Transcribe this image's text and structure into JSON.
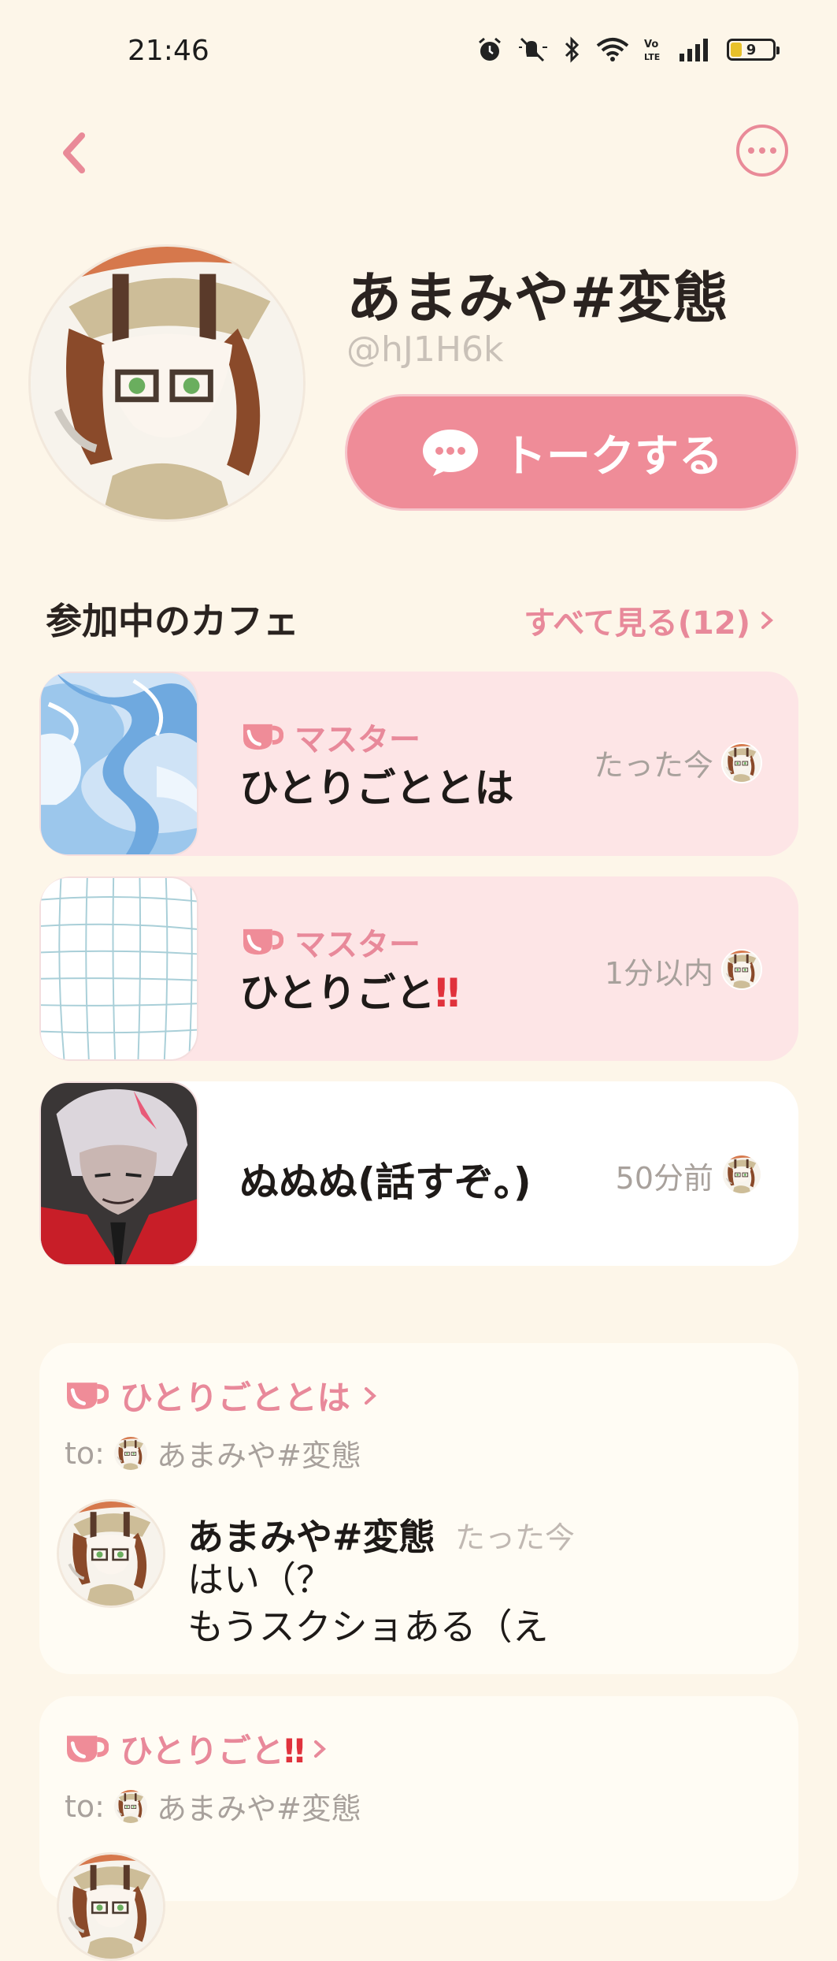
{
  "status_bar": {
    "time": "21:46",
    "battery": "9",
    "icons": [
      "alarm-icon",
      "mute-icon",
      "bluetooth-icon",
      "wifi-icon",
      "volte-icon",
      "signal-icon",
      "battery-icon"
    ]
  },
  "header": {
    "back_icon": "chevron-left-icon",
    "more_icon": "more-dots-icon"
  },
  "profile": {
    "name": "あまみや#変態",
    "user_id": "@hJ1H6k",
    "talk_button": "トークする"
  },
  "cafes_section": {
    "title": "参加中のカフェ",
    "see_all": "すべて見る(12)",
    "items": [
      {
        "badge": "マスター",
        "name": "ひとりごととは",
        "time": "たった今"
      },
      {
        "badge": "マスター",
        "name": "ひとりごと",
        "name_suffix": "‼",
        "time": "1分以内"
      },
      {
        "name": "ぬぬぬ(話すぞ。)",
        "time": "50分前"
      }
    ]
  },
  "posts": [
    {
      "cafe": "ひとりごととは",
      "to_prefix": "to:",
      "to_name": "あまみや#変態",
      "author": "あまみや#変態",
      "time": "たった今",
      "lines": [
        "はい（？",
        "もうスクショある（え"
      ]
    },
    {
      "cafe": "ひとりごと",
      "cafe_suffix": "‼",
      "to_prefix": "to:",
      "to_name": "あまみや#変態"
    }
  ],
  "colors": {
    "background": "#fdf6e9",
    "accent_pink": "#ef8c98",
    "label_pink": "#e8899a",
    "card_pink": "#fde5e6"
  }
}
